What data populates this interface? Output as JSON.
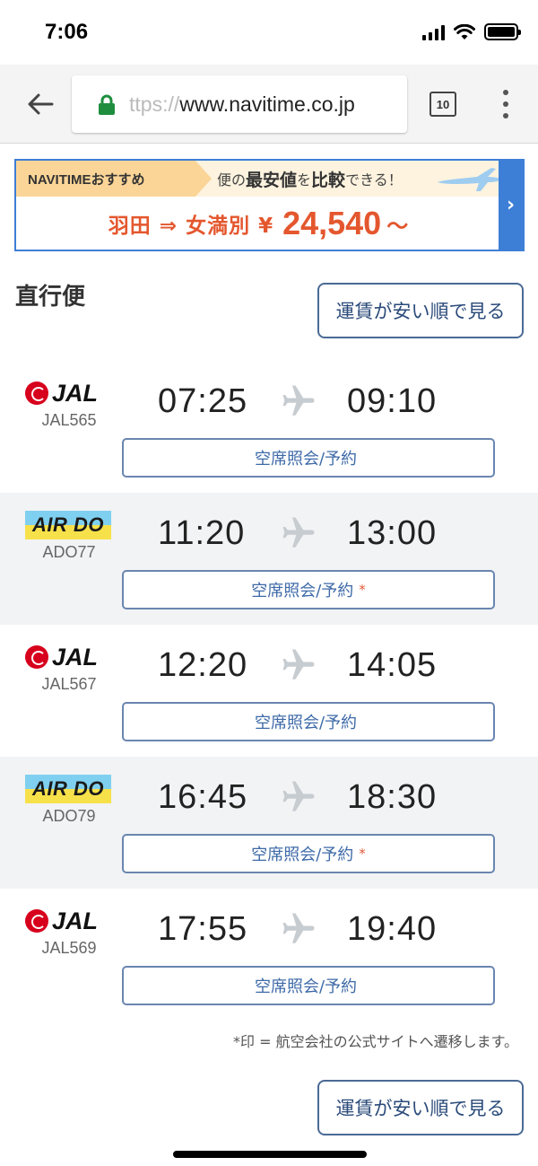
{
  "status_bar": {
    "time": "7:06"
  },
  "browser": {
    "url_faded": "ttps://",
    "url_main": "www.navitime.co.jp",
    "tab_count": "10"
  },
  "banner": {
    "tag": "NAVITIMEおすすめ",
    "compare_pre": "便の",
    "compare_bold1": "最安値",
    "compare_mid": "を",
    "compare_bold2": "比較",
    "compare_post": "できる！",
    "route": "羽田 ⇒ 女満別 ¥",
    "price": "24,540",
    "tilde": "〜",
    "arrow": "›"
  },
  "section": {
    "title": "直行便"
  },
  "sort_button_label": "運賃が安い順で見る",
  "flights": [
    {
      "airline": "JAL",
      "flight_no": "JAL565",
      "dep": "07:25",
      "arr": "09:10",
      "reserve": "空席照会/予約",
      "mark": ""
    },
    {
      "airline": "AIR DO",
      "flight_no": "ADO77",
      "dep": "11:20",
      "arr": "13:00",
      "reserve": "空席照会/予約",
      "mark": "*"
    },
    {
      "airline": "JAL",
      "flight_no": "JAL567",
      "dep": "12:20",
      "arr": "14:05",
      "reserve": "空席照会/予約",
      "mark": ""
    },
    {
      "airline": "AIR DO",
      "flight_no": "ADO79",
      "dep": "16:45",
      "arr": "18:30",
      "reserve": "空席照会/予約",
      "mark": "*"
    },
    {
      "airline": "JAL",
      "flight_no": "JAL569",
      "dep": "17:55",
      "arr": "19:40",
      "reserve": "空席照会/予約",
      "mark": ""
    }
  ],
  "footnote": "*印 = 航空会社の公式サイトへ遷移します。",
  "colors": {
    "accent_blue": "#3d7fd6",
    "price_red": "#e4572e",
    "jal_red": "#d7001d",
    "ado_blue": "#7fd0f0",
    "ado_yellow": "#f7e14a"
  },
  "icons": [
    "signal-icon",
    "wifi-icon",
    "battery-icon",
    "back-arrow-icon",
    "lock-icon",
    "tabs-icon",
    "overflow-menu-icon",
    "plane-icon"
  ]
}
